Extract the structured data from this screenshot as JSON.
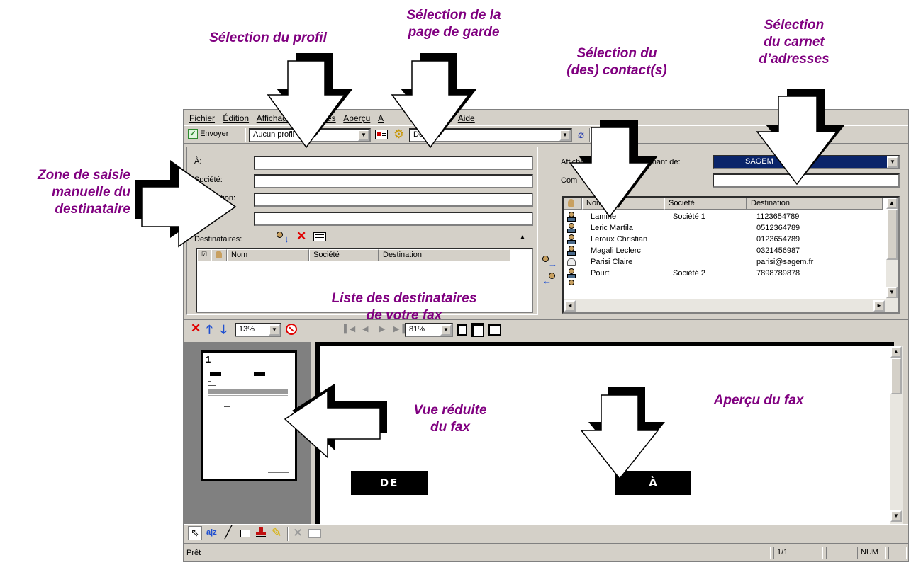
{
  "callouts": {
    "profil": "Sélection du profil",
    "page_garde": "Sélection de la\npage de garde",
    "contacts": "Sélection du\n(des) contact(s)",
    "carnet": "Sélection\ndu carnet\nd’adresses",
    "zone_saisie": "Zone de saisie\nmanuelle du\ndestinataire",
    "liste": "Liste des destinataires\nde votre fax",
    "vue_reduite": "Vue réduite\ndu fax",
    "apercu": "Aperçu du fax"
  },
  "menu": [
    "Fichier",
    "Édition",
    "Affichage",
    "Produites",
    "Aperçu",
    "A",
    "Outils",
    "Aide"
  ],
  "toolbar": {
    "send_label": "Envoyer",
    "profile_value": "Aucun profil",
    "cover_value": "De"
  },
  "recipient_form": {
    "to_label": "À:",
    "company_label": "Société:",
    "destination_label": "Destination:",
    "subject_label": "Objet:",
    "recipients_label": "Destinataires:"
  },
  "recipients_table": {
    "columns": [
      "Nom",
      "Société",
      "Destination"
    ]
  },
  "addressbook": {
    "show_label": "Afficher les contacts provenant de:",
    "comment_label": "Com",
    "source_value": "SAGEM",
    "columns": [
      "Nom",
      "Société",
      "Destination"
    ],
    "rows": [
      {
        "name": "Lamine",
        "company": "Société 1",
        "destination": "1123654789",
        "icon": "person-icon"
      },
      {
        "name": "Leric Martila",
        "company": "",
        "destination": "0512364789",
        "icon": "person-icon"
      },
      {
        "name": "Leroux Christian",
        "company": "",
        "destination": "0123654789",
        "icon": "person-icon"
      },
      {
        "name": "Magali Leclerc",
        "company": "",
        "destination": "0321456987",
        "icon": "person-icon"
      },
      {
        "name": "Parisi Claire",
        "company": "",
        "destination": "parisi@sagem.fr",
        "icon": "mail-icon"
      },
      {
        "name": "Pourti",
        "company": "Société 2",
        "destination": "7898789878",
        "icon": "person-icon"
      }
    ]
  },
  "preview_toolbar": {
    "thumb_zoom": "13%",
    "page_zoom": "81%"
  },
  "preview": {
    "page_number": "1",
    "from_box": "DE",
    "to_box": "À"
  },
  "status": {
    "text": "Prêt",
    "page": "1/1",
    "num": "NUM"
  },
  "colors": {
    "callout": "#800080",
    "window_bg": "#d4d0c8",
    "selection": "#0a246a"
  }
}
